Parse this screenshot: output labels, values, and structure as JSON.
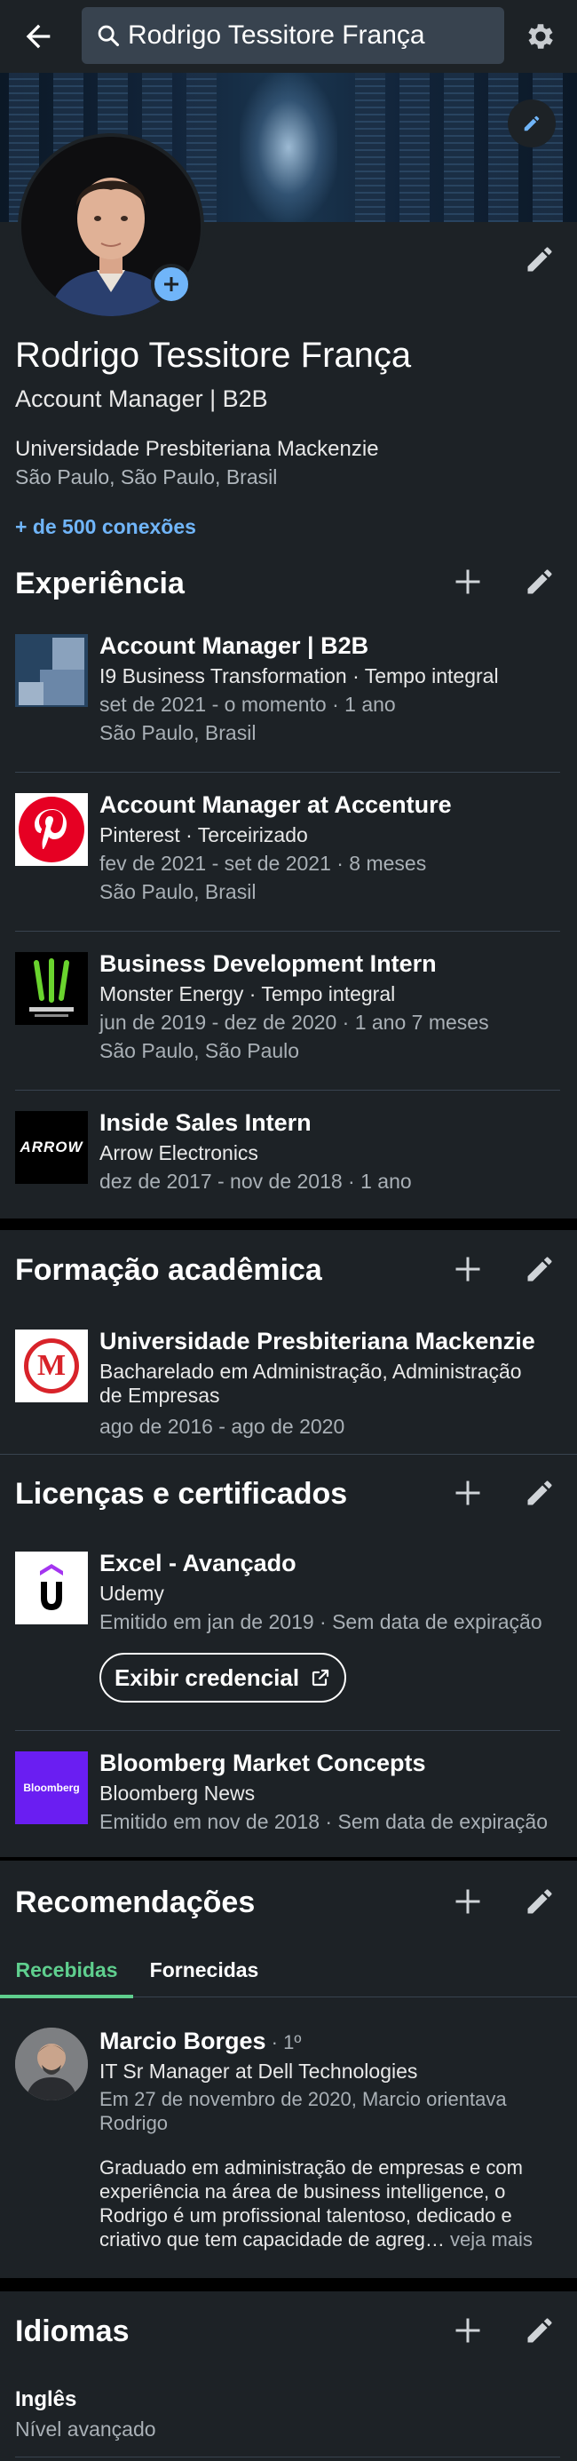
{
  "search": {
    "query": "Rodrigo Tessitore França"
  },
  "profile": {
    "name": "Rodrigo Tessitore França",
    "headline": "Account Manager | B2B",
    "school": "Universidade Presbiteriana Mackenzie",
    "location": "São Paulo, São Paulo, Brasil",
    "connections": "+ de 500 conexões"
  },
  "experience": {
    "title": "Experiência",
    "items": [
      {
        "title": "Account Manager | B2B",
        "company": "I9 Business Transformation · Tempo integral",
        "dates": "set de 2021 - o momento · 1 ano",
        "location": "São Paulo, Brasil",
        "logo": "i9-logo"
      },
      {
        "title": "Account Manager at Accenture",
        "company": "Pinterest · Terceirizado",
        "dates": "fev de 2021 - set de 2021 · 8 meses",
        "location": "São Paulo, Brasil",
        "logo": "pinterest-logo"
      },
      {
        "title": "Business Development Intern",
        "company": "Monster Energy · Tempo integral",
        "dates": "jun de 2019 - dez de 2020 · 1 ano 7 meses",
        "location": "São Paulo, São Paulo",
        "logo": "monster-logo"
      },
      {
        "title": "Inside Sales Intern",
        "company": "Arrow Electronics",
        "dates": "dez de 2017 - nov de 2018 · 1 ano",
        "logo": "arrow-logo",
        "logo_text": "ARROW"
      }
    ]
  },
  "education": {
    "title": "Formação acadêmica",
    "items": [
      {
        "school": "Universidade Presbiteriana Mackenzie",
        "degree_line1": "Bacharelado em Administração, Administração",
        "degree_line2": "de Empresas",
        "dates": "ago de 2016 - ago de 2020",
        "logo": "mackenzie-logo",
        "logo_text": "M"
      }
    ]
  },
  "licenses": {
    "title": "Licenças e certificados",
    "items": [
      {
        "name": "Excel - Avançado",
        "issuer": "Udemy",
        "issued": "Emitido em jan de 2019 · Sem data de expiração",
        "button": "Exibir credencial",
        "logo": "udemy-logo",
        "logo_text": "U"
      },
      {
        "name": "Bloomberg Market Concepts",
        "issuer": "Bloomberg News",
        "issued": "Emitido em nov de 2018 · Sem data de expiração",
        "logo": "bloomberg-logo",
        "logo_text": "Bloomberg"
      }
    ]
  },
  "recommendations": {
    "title": "Recomendações",
    "tabs": [
      "Recebidas",
      "Fornecidas"
    ],
    "items": [
      {
        "name": "Marcio Borges",
        "degree": " · 1º",
        "role": "IT Sr Manager at Dell Technologies",
        "context_line1": "Em 27 de novembro de 2020, Marcio orientava",
        "context_line2": "Rodrigo",
        "text": "Graduado em administração de empresas e com experiência na área de business intelligence, o Rodrigo é um profissional talentoso, dedicado e criativo que tem capacidade de agreg…",
        "see_more": " veja mais"
      }
    ]
  },
  "languages": {
    "title": "Idiomas",
    "items": [
      {
        "language": "Inglês",
        "level": "Nível avançado"
      }
    ]
  },
  "colors": {
    "card_bg": "#1d2226",
    "page_bg": "#000000",
    "link": "#70b5f9",
    "tab_active": "#5fcf8e"
  }
}
